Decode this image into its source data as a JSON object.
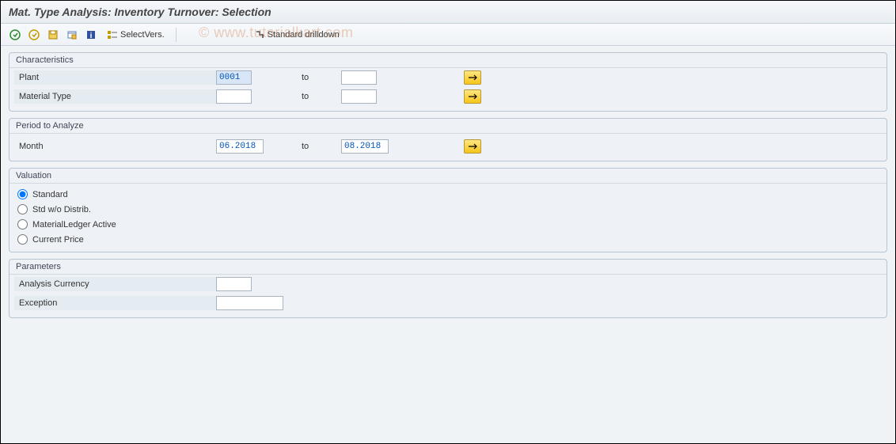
{
  "title": "Mat. Type Analysis: Inventory Turnover: Selection",
  "watermark": "© www.tutorialkart.com",
  "toolbar": {
    "selectVersLabel": "SelectVers.",
    "stdDrilldownLabel": "Standard drilldown"
  },
  "groups": {
    "characteristics": {
      "title": "Characteristics",
      "plantLabel": "Plant",
      "plantFrom": "0001",
      "plantTo": "",
      "materialTypeLabel": "Material Type",
      "materialTypeFrom": "",
      "materialTypeTo": "",
      "toLabel": "to"
    },
    "period": {
      "title": "Period to Analyze",
      "monthLabel": "Month",
      "monthFrom": "06.2018",
      "monthTo": "08.2018",
      "toLabel": "to"
    },
    "valuation": {
      "title": "Valuation",
      "options": {
        "standard": "Standard",
        "stdNoDistrib": "Std w/o Distrib.",
        "mlActive": "MaterialLedger Active",
        "currentPrice": "Current Price"
      },
      "selected": "standard"
    },
    "parameters": {
      "title": "Parameters",
      "analysisCurrencyLabel": "Analysis Currency",
      "analysisCurrency": "",
      "exceptionLabel": "Exception",
      "exception": ""
    }
  }
}
